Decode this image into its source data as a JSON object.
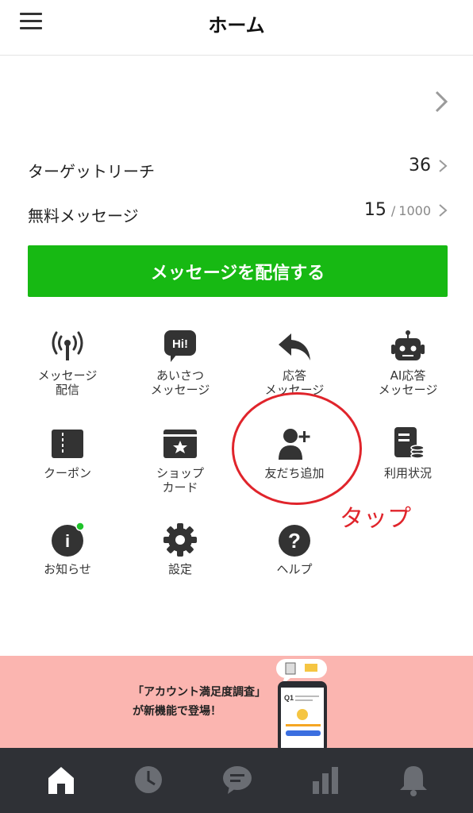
{
  "header": {
    "title": "ホーム",
    "menu_icon": "hamburger-menu-icon"
  },
  "stats": {
    "target_reach": {
      "label": "ターゲットリーチ",
      "value": "36"
    },
    "free_messages": {
      "label": "無料メッセージ",
      "value": "15",
      "separator": "/",
      "max": "1000"
    }
  },
  "cta": {
    "label": "メッセージを配信する",
    "color": "#17b913"
  },
  "grid": [
    {
      "label": "メッセージ\n配信",
      "icon": "broadcast-antenna-icon"
    },
    {
      "label": "あいさつ\nメッセージ",
      "icon": "hi-speech-bubble-icon",
      "icon_text": "Hi!"
    },
    {
      "label": "応答\nメッセージ",
      "icon": "reply-arrow-icon"
    },
    {
      "label": "AI応答\nメッセージ",
      "icon": "robot-icon"
    },
    {
      "label": "クーポン",
      "icon": "coupon-icon"
    },
    {
      "label": "ショップ\nカード",
      "icon": "shop-card-icon"
    },
    {
      "label": "友だち追加",
      "icon": "add-friend-icon"
    },
    {
      "label": "利用状況",
      "icon": "usage-document-icon"
    },
    {
      "label": "お知らせ",
      "icon": "info-icon",
      "icon_text": "i"
    },
    {
      "label": "設定",
      "icon": "gear-icon"
    },
    {
      "label": "ヘルプ",
      "icon": "help-icon",
      "icon_text": "?"
    }
  ],
  "annotation": {
    "text": "タップ",
    "color": "#e0242b"
  },
  "banner": {
    "line1": "「アカウント満足度調査」",
    "line2": "が新機能で登場！",
    "phone_label": "Q1",
    "background": "#fbb5b0"
  },
  "tabbar": {
    "background": "#2f3136",
    "tabs": [
      {
        "icon": "home-icon",
        "active": true
      },
      {
        "icon": "clock-icon",
        "active": false
      },
      {
        "icon": "chat-icon",
        "active": false
      },
      {
        "icon": "bar-chart-icon",
        "active": false
      },
      {
        "icon": "bell-icon",
        "active": false
      }
    ]
  }
}
